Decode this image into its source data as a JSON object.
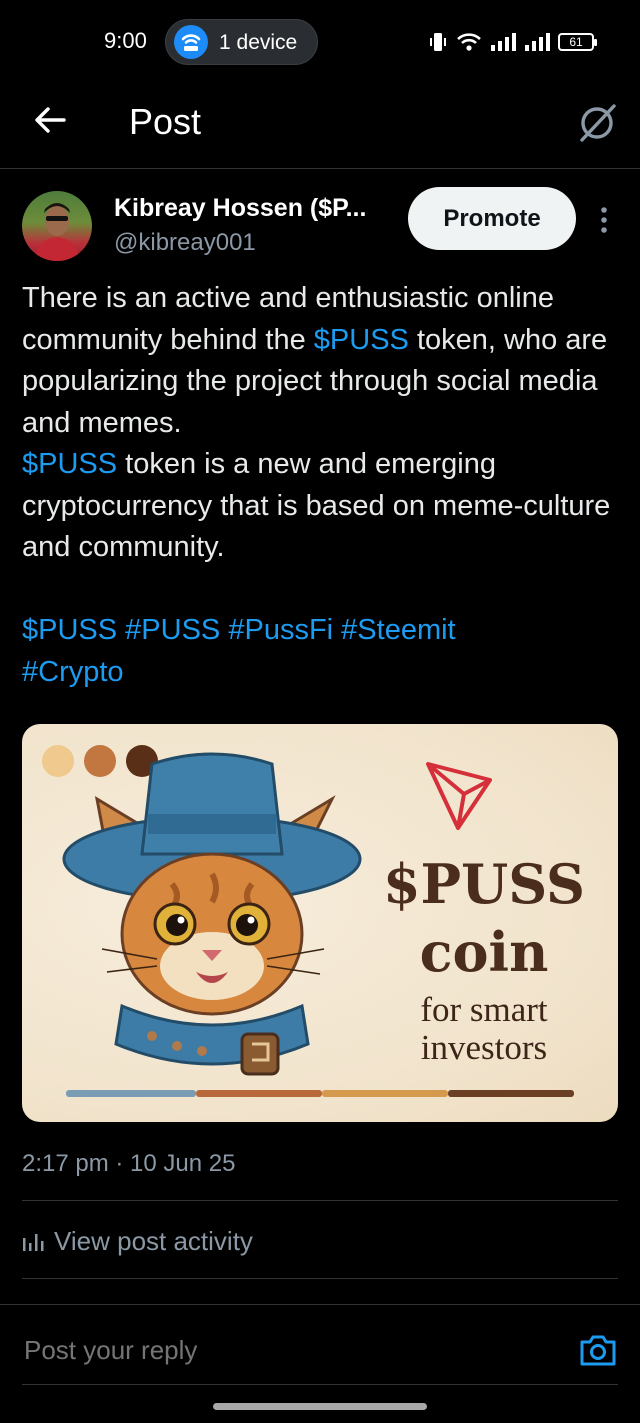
{
  "status_bar": {
    "time": "9:00",
    "device_pill": "1 device",
    "battery": "61"
  },
  "header": {
    "title": "Post"
  },
  "author": {
    "name": "Kibreay Hossen ($P...",
    "handle": "@kibreay001",
    "promote_label": "Promote"
  },
  "post": {
    "line1_pre": "There is an active and enthusiastic online community behind the ",
    "line1_link": "$PUSS",
    "line1_post": " token, who are popularizing the project through social media and memes.",
    "line2_link": "$PUSS",
    "line2_post": " token is a new and emerging cryptocurrency that is based on meme-culture and community.",
    "hashtags": [
      "$PUSS",
      "#PUSS",
      "#PussFi",
      "#Steemit",
      "#Crypto"
    ]
  },
  "card": {
    "title": "$PUSS",
    "subtitle": "coin",
    "tagline1": "for smart",
    "tagline2": "investors",
    "dots": [
      "#efc98e",
      "#c1773f",
      "#5a2f17"
    ],
    "bar_colors": [
      "#7a9cb4",
      "#b8683a",
      "#d69a4e",
      "#6b3f24"
    ]
  },
  "timestamp": "2:17 pm · 10 Jun 25",
  "activity_label": "View post activity",
  "reply": {
    "placeholder": "Post your reply"
  },
  "colors": {
    "link": "#1d9bf0",
    "background": "#000000",
    "muted": "#8b98a5"
  }
}
